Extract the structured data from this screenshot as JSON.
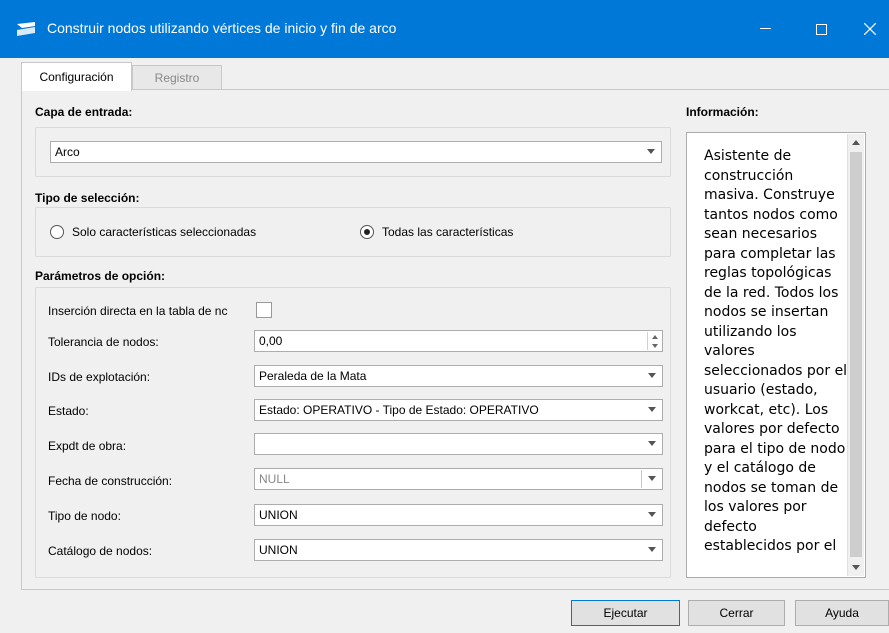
{
  "window": {
    "title": "Construir nodos utilizando vértices de inicio y fin de arco",
    "controls": {
      "minimize": "—",
      "maximize": "☐",
      "close": "✕"
    }
  },
  "tabs": [
    {
      "label": "Configuración",
      "active": true
    },
    {
      "label": "Registro",
      "active": false
    }
  ],
  "input_layer": {
    "title": "Capa de entrada:",
    "value": "Arco"
  },
  "selection_type": {
    "title": "Tipo de selección:",
    "options": [
      {
        "label": "Solo características seleccionadas",
        "checked": false
      },
      {
        "label": "Todas las características",
        "checked": true
      }
    ]
  },
  "options": {
    "title": "Parámetros de opción:",
    "direct_insert": {
      "label": "Inserción directa en la tabla de nc",
      "checked": false
    },
    "tolerance": {
      "label": "Tolerancia de nodos:",
      "value": "0,00"
    },
    "exploitation": {
      "label": "IDs de explotación:",
      "value": "Peraleda de la Mata"
    },
    "state": {
      "label": "Estado:",
      "value": "Estado: OPERATIVO - Tipo de Estado: OPERATIVO"
    },
    "expdt": {
      "label": "Expdt de obra:",
      "value": ""
    },
    "build_date": {
      "label": "Fecha de construcción:",
      "value": "NULL"
    },
    "node_type": {
      "label": "Tipo de nodo:",
      "value": "UNION"
    },
    "node_catalog": {
      "label": "Catálogo de nodos:",
      "value": "UNION"
    }
  },
  "info": {
    "title": "Información:",
    "text": "Asistente de construcción masiva. Construye tantos nodos como sean necesarios para completar las reglas topológicas de la red. Todos los nodos se insertan utilizando los valores seleccionados por el usuario (estado, workcat, etc). Los valores por defecto para el tipo de nodo y el catálogo de nodos se toman de los valores por defecto establecidos por el"
  },
  "buttons": {
    "run": "Ejecutar",
    "close": "Cerrar",
    "help": "Ayuda"
  },
  "colors": {
    "titlebar": "#0078d7",
    "background": "#f0f0f0"
  }
}
